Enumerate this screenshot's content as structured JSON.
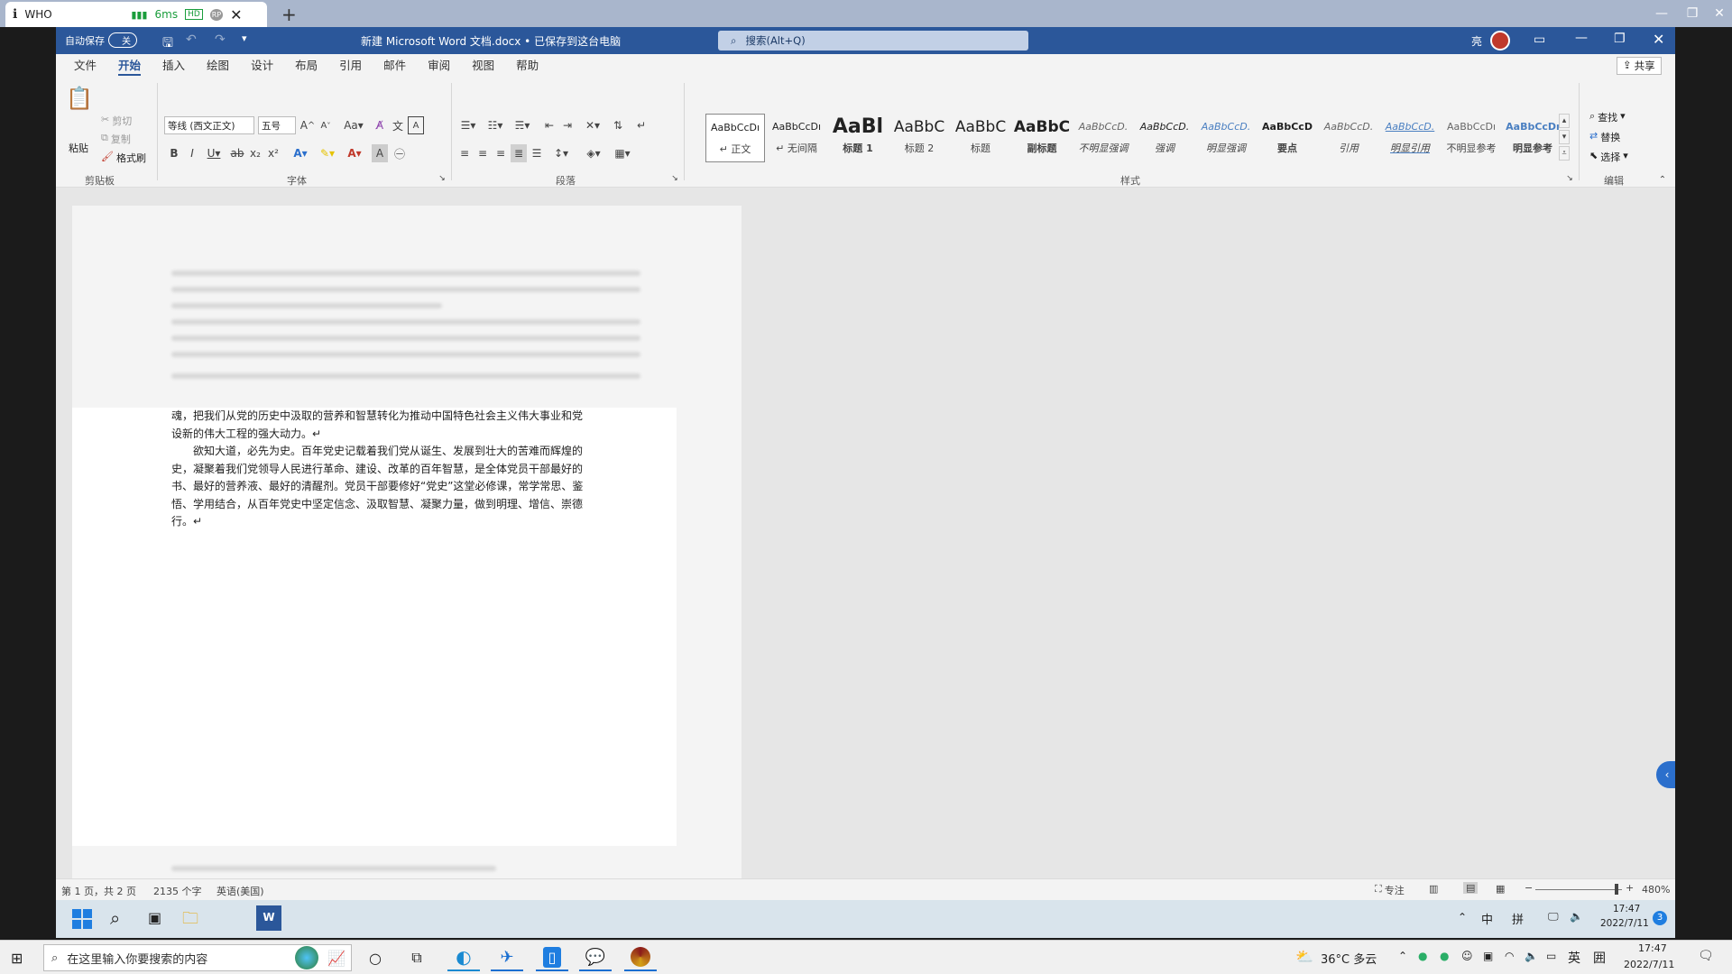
{
  "remote": {
    "tab_title": "WHO",
    "latency": "6ms",
    "badge_hd": "HD",
    "badge_rp": "RP"
  },
  "word": {
    "autosave_label": "自动保存",
    "autosave_state": "关",
    "doc_title": "新建 Microsoft Word 文档.docx • 已保存到这台电脑",
    "search_placeholder": "搜索(Alt+Q)",
    "user_name": "亮",
    "share_label": "共享",
    "tabs": [
      "文件",
      "开始",
      "插入",
      "绘图",
      "设计",
      "布局",
      "引用",
      "邮件",
      "审阅",
      "视图",
      "帮助"
    ],
    "clipboard": {
      "paste": "粘贴",
      "cut": "剪切",
      "copy": "复制",
      "format_painter": "格式刷",
      "group": "剪贴板"
    },
    "font": {
      "font_name": "等线 (西文正文)",
      "font_size": "五号",
      "group": "字体"
    },
    "paragraph_group": "段落",
    "styles_group": "样式",
    "editing": {
      "find": "查找",
      "replace": "替换",
      "select": "选择",
      "group": "编辑"
    },
    "styles": [
      {
        "sample": "AaBbCcDı",
        "name": "↵ 正文"
      },
      {
        "sample": "AaBbCcDı",
        "name": "↵ 无间隔"
      },
      {
        "sample": "AaBl",
        "name": "标题 1"
      },
      {
        "sample": "AaBbC",
        "name": "标题 2"
      },
      {
        "sample": "AaBbC",
        "name": "标题"
      },
      {
        "sample": "AaBbC",
        "name": "副标题"
      },
      {
        "sample": "AaBbCcD.",
        "name": "不明显强调"
      },
      {
        "sample": "AaBbCcD.",
        "name": "强调"
      },
      {
        "sample": "AaBbCcD.",
        "name": "明显强调"
      },
      {
        "sample": "AaBbCcD",
        "name": "要点"
      },
      {
        "sample": "AaBbCcD.",
        "name": "引用"
      },
      {
        "sample": "AaBbCcD.",
        "name": "明显引用"
      },
      {
        "sample": "AaBbCcDı",
        "name": "不明显参考"
      },
      {
        "sample": "AaBbCcDı",
        "name": "明显参考"
      }
    ],
    "document_lines": [
      "魂，把我们从党的历史中汲取的营养和智慧转化为推动中国特色社会主义伟大事业和党",
      "设新的伟大工程的强大动力。↵",
      "　　欲知大道，必先为史。百年党史记载着我们党从诞生、发展到壮大的苦难而辉煌的",
      "史，凝聚着我们党领导人民进行革命、建设、改革的百年智慧，是全体党员干部最好的",
      "书、最好的营养液、最好的清醒剂。党员干部要修好“党史”这堂必修课，常学常思、鉴",
      "悟、学用结合，从百年党史中坚定信念、汲取智慧、凝聚力量，做到明理、增信、崇德",
      "行。↵"
    ],
    "status": {
      "page": "第 1 页，共 2 页",
      "words": "2135 个字",
      "language": "英语(美国)",
      "focus": "专注",
      "zoom": "480%"
    }
  },
  "inner_taskbar": {
    "time": "17:47",
    "date": "2022/7/11",
    "ime": "中",
    "ime2": "拼",
    "badge": "3"
  },
  "taskbar": {
    "search_placeholder": "在这里输入你要搜索的内容",
    "weather": "36°C 多云",
    "ime": "英",
    "ime2": "囲",
    "time": "17:47",
    "date": "2022/7/11"
  },
  "colors": {
    "word_blue": "#2b579a",
    "ribbon_bg": "#f3f3f3",
    "doc_bg": "#e6e6e6"
  }
}
